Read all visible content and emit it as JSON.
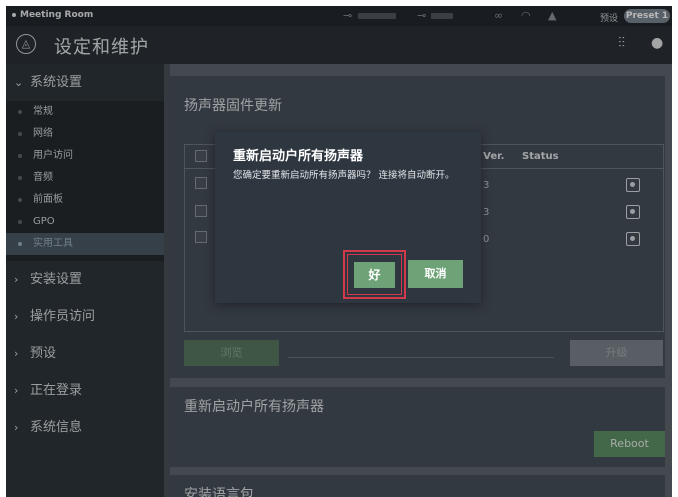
{
  "topbar": {
    "room": "Meeting Room",
    "preset_label": "预设",
    "preset_value": "Preset 1",
    "icons": [
      "input-icon",
      "output-icon",
      "link-icon",
      "signal-icon",
      "warning-icon"
    ]
  },
  "titlebar": {
    "title": "设定和维护",
    "icons": [
      "logo-icon",
      "mixer-sliders-icon",
      "user-icon"
    ]
  },
  "sidebar": {
    "system_settings": "系统设置",
    "sub_items": [
      "常规",
      "网络",
      "用户访问",
      "音频",
      "前面板",
      "GPO",
      "实用工具"
    ],
    "active_sub": "实用工具",
    "sections": [
      "安装设置",
      "操作员访问",
      "预设",
      "正在登录",
      "系统信息"
    ]
  },
  "firmware": {
    "title": "扬声器固件更新",
    "col_ver": "/ Ver.",
    "col_status": "Status",
    "rows": [
      {
        "ver": "3"
      },
      {
        "ver": "3"
      },
      {
        "ver": "0"
      }
    ],
    "browse_label": "浏览",
    "upgrade_label": "升级"
  },
  "reboot_section": {
    "title": "重新启动户所有扬声器",
    "button": "Reboot"
  },
  "language_section": {
    "title": "安装语言包"
  },
  "dialog": {
    "title": "重新启动户所有扬声器",
    "message": "您确定要重新启动所有扬声器吗？ 连接将自动断开。",
    "ok_label": "好",
    "cancel_label": "取消"
  },
  "colors": {
    "accent_green": "#6ea377",
    "highlight_red": "#d23a4c",
    "sidebar_active": "#4c5964"
  }
}
